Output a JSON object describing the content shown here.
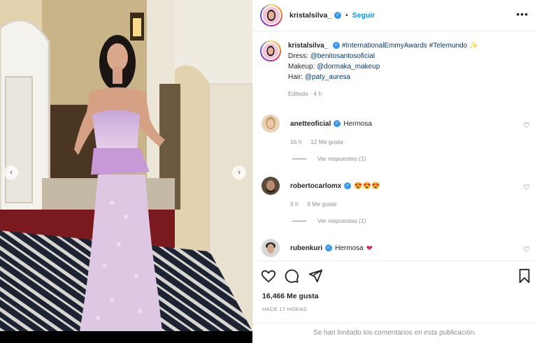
{
  "header": {
    "username": "kristalsilva_",
    "separator": "•",
    "follow_label": "Seguir",
    "more_label": "•••"
  },
  "caption": {
    "username": "kristalsilva_",
    "hashtags": "#InternationalEmmyAwards #Telemundo",
    "emoji": "✨",
    "dress_label": "Dress:",
    "dress_handle": "@benitosantosoficial",
    "makeup_label": "Makeup:",
    "makeup_handle": "@dormaka_makeup",
    "hair_label": "Hair:",
    "hair_handle": "@paty_auresa",
    "meta": "Editado · 4 h"
  },
  "comments": [
    {
      "username": "anetteoficial",
      "verified": true,
      "text": "Hermosa",
      "time": "16 h",
      "likes": "12 Me gusta",
      "replies": "Ver respuestas (1)"
    },
    {
      "username": "robertocarlomx",
      "verified": true,
      "text": "😍😍😍",
      "time": "9 h",
      "likes": "9 Me gusta",
      "replies": "Ver respuestas (1)"
    },
    {
      "username": "rubenkuri",
      "verified": true,
      "text": "Hermosa",
      "emoji": "❤"
    }
  ],
  "footer": {
    "likes": "16,466 Me gusta",
    "ago": "HACE 17 HORAS",
    "limited": "Se han limitado los comentarios en esta publicación."
  },
  "icons": {
    "heart": "heart-icon",
    "comment": "comment-icon",
    "share": "share-icon",
    "save": "bookmark-icon"
  },
  "colors": {
    "follow": "#0095f6",
    "verified": "#3897f0",
    "muted": "#8e8e8e",
    "heart_emoji": "#e0245e"
  }
}
